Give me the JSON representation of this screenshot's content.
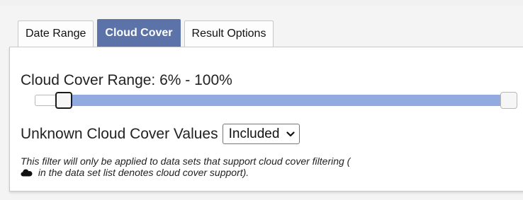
{
  "tabs": [
    {
      "label": "Date Range",
      "active": false
    },
    {
      "label": "Cloud Cover",
      "active": true
    },
    {
      "label": "Result Options",
      "active": false
    }
  ],
  "cloud_cover": {
    "range_label": "Cloud Cover Range: 6% - 100%",
    "min_value": 6,
    "max_value": 100,
    "scale_min": 0,
    "scale_max": 100,
    "unknown_label": "Unknown Cloud Cover Values",
    "unknown_selected": "Included",
    "note_line1": "This filter will only be applied to data sets that support cloud cover filtering (",
    "note_line2": " in the data set list denotes cloud cover support).",
    "note_icon": "cloud-icon"
  },
  "colors": {
    "active_tab": "#5b73a8",
    "range_fill": "#91aadf"
  }
}
